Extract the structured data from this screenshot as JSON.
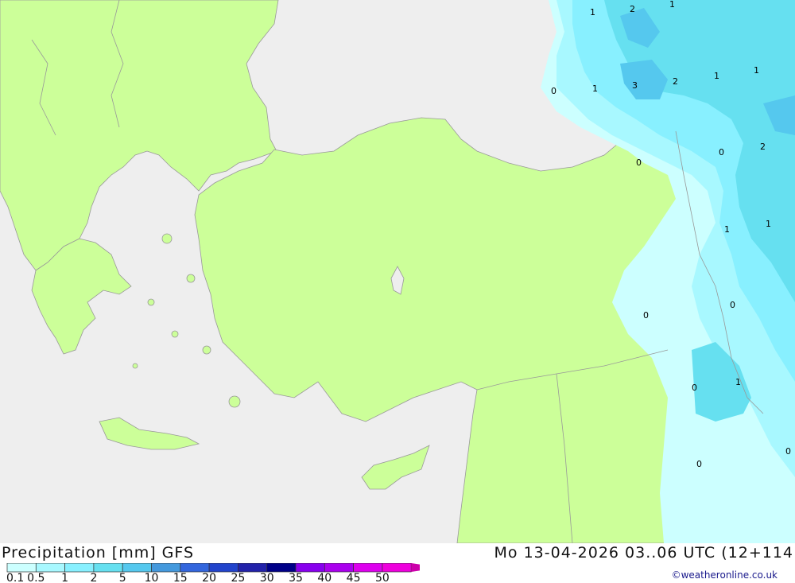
{
  "header": {
    "title": "Precipitation [mm] GFS",
    "valid_time": "Mo 13-04-2026 03..06 UTC (12+114",
    "credit": "©weatheronline.co.uk"
  },
  "colors": {
    "sea": "#eeeeee",
    "land": "#ccff99",
    "border": "#999999"
  },
  "legend": {
    "labels": [
      "0.1",
      "0.5",
      "1",
      "2",
      "5",
      "10",
      "15",
      "20",
      "25",
      "30",
      "35",
      "40",
      "45",
      "50"
    ],
    "colors": [
      "#ccffff",
      "#a8f8ff",
      "#88f0ff",
      "#66e0f0",
      "#55c8ee",
      "#4499dd",
      "#3366dd",
      "#2244cc",
      "#2222aa",
      "#000088",
      "#8800ee",
      "#aa00ee",
      "#dd00ee",
      "#ee00dd",
      "#cc00aa"
    ]
  },
  "map_labels": [
    "1",
    "2",
    "1",
    "0",
    "1",
    "3",
    "2",
    "1",
    "1",
    "0",
    "0",
    "2",
    "1",
    "1",
    "0",
    "0",
    "0",
    "1",
    "0",
    "0"
  ]
}
